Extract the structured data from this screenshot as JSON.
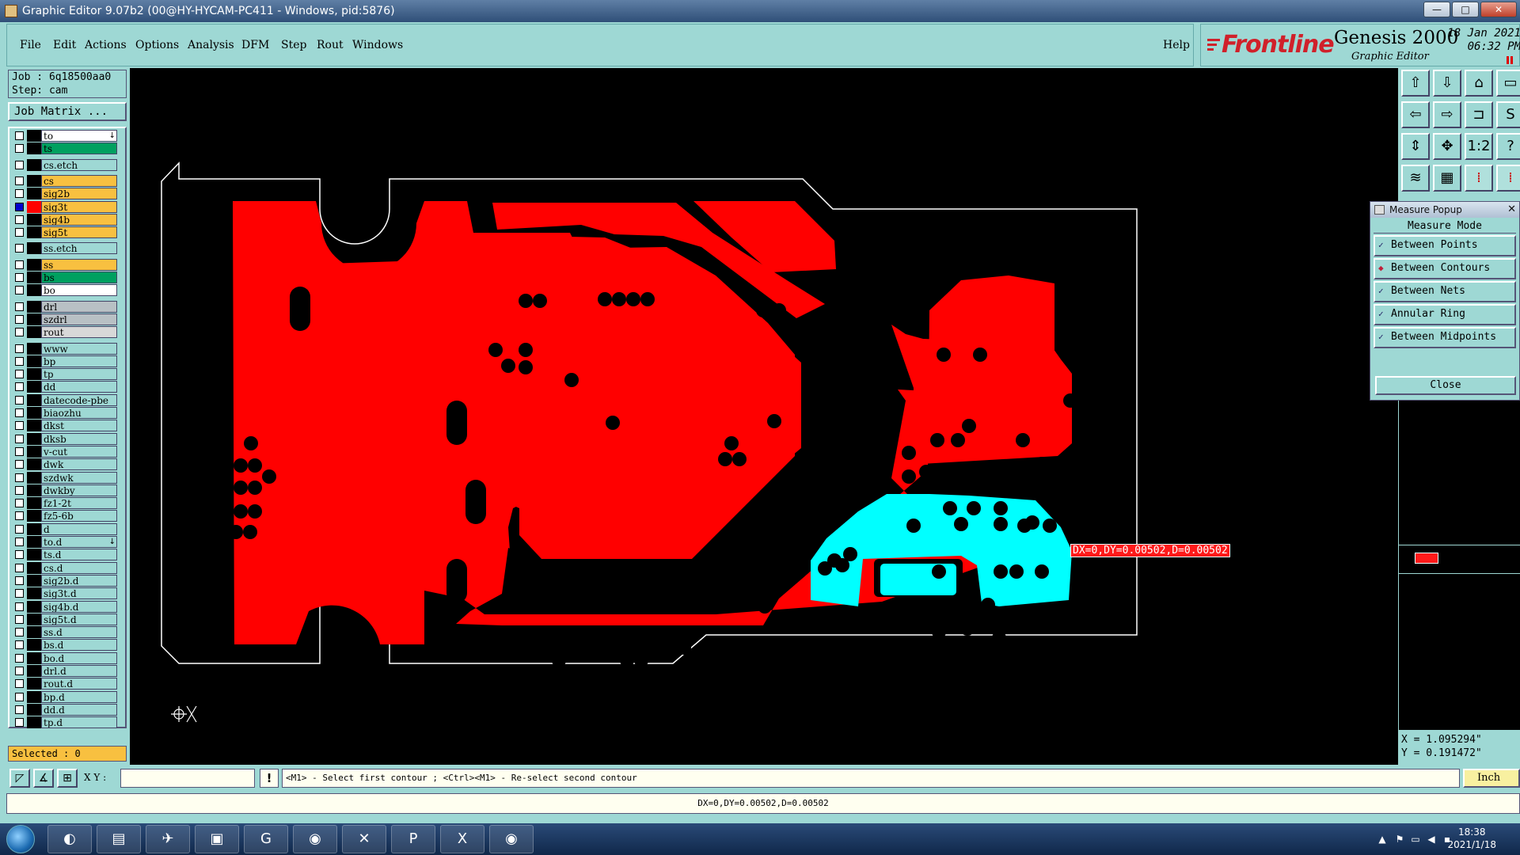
{
  "window": {
    "title": "Graphic Editor 9.07b2 (00@HY-HYCAM-PC411 - Windows, pid:5876)"
  },
  "window_buttons": {
    "minimize": "—",
    "maximize": "□",
    "close": "✕"
  },
  "menu": {
    "items": [
      "File",
      "Edit",
      "Actions",
      "Options",
      "Analysis",
      "DFM",
      "Step",
      "Rout",
      "Windows"
    ],
    "help": "Help"
  },
  "brand": {
    "logo": "Frontline",
    "product": "Genesis 2000",
    "subtitle": "Graphic Editor",
    "date": "18 Jan 2021",
    "time": "06:32 PM"
  },
  "job": {
    "job_line": "Job : 6q18500aa0",
    "step_line": "Step: cam",
    "matrix_button": "Job Matrix ..."
  },
  "layers": [
    {
      "name": "to",
      "color": "#ffffff",
      "mark": "↓"
    },
    {
      "name": "ts",
      "color": "#00a060"
    },
    {
      "name": "cs.etch",
      "color": "#9ed8d4"
    },
    {
      "name": "cs",
      "color": "#f8c040"
    },
    {
      "name": "sig2b",
      "color": "#f8c040"
    },
    {
      "name": "sig3t",
      "color": "#f8c040",
      "selected": true
    },
    {
      "name": "sig4b",
      "color": "#f8c040"
    },
    {
      "name": "sig5t",
      "color": "#f8c040"
    },
    {
      "name": "ss.etch",
      "color": "#9ed8d4"
    },
    {
      "name": "ss",
      "color": "#f8c040"
    },
    {
      "name": "bs",
      "color": "#00a060"
    },
    {
      "name": "bo",
      "color": "#ffffff"
    },
    {
      "name": "drl",
      "color": "#b8c0c4"
    },
    {
      "name": "szdrl",
      "color": "#b8c0c4"
    },
    {
      "name": "rout",
      "color": "#d8d8d8"
    },
    {
      "name": "www",
      "color": "#9ed8d4"
    },
    {
      "name": "bp",
      "color": "#9ed8d4"
    },
    {
      "name": "tp",
      "color": "#9ed8d4"
    },
    {
      "name": "dd",
      "color": "#9ed8d4"
    },
    {
      "name": "datecode-pbe",
      "color": "#9ed8d4"
    },
    {
      "name": "biaozhu",
      "color": "#9ed8d4"
    },
    {
      "name": "dkst",
      "color": "#9ed8d4"
    },
    {
      "name": "dksb",
      "color": "#9ed8d4"
    },
    {
      "name": "v-cut",
      "color": "#9ed8d4"
    },
    {
      "name": "dwk",
      "color": "#9ed8d4"
    },
    {
      "name": "szdwk",
      "color": "#9ed8d4"
    },
    {
      "name": "dwkby",
      "color": "#9ed8d4"
    },
    {
      "name": "fz1-2t",
      "color": "#9ed8d4"
    },
    {
      "name": "fz5-6b",
      "color": "#9ed8d4"
    },
    {
      "name": "d",
      "color": "#9ed8d4"
    },
    {
      "name": "to.d",
      "color": "#9ed8d4",
      "mark": "↓"
    },
    {
      "name": "ts.d",
      "color": "#9ed8d4"
    },
    {
      "name": "cs.d",
      "color": "#9ed8d4"
    },
    {
      "name": "sig2b.d",
      "color": "#9ed8d4"
    },
    {
      "name": "sig3t.d",
      "color": "#9ed8d4"
    },
    {
      "name": "sig4b.d",
      "color": "#9ed8d4"
    },
    {
      "name": "sig5t.d",
      "color": "#9ed8d4"
    },
    {
      "name": "ss.d",
      "color": "#9ed8d4"
    },
    {
      "name": "bs.d",
      "color": "#9ed8d4"
    },
    {
      "name": "bo.d",
      "color": "#9ed8d4"
    },
    {
      "name": "drl.d",
      "color": "#9ed8d4"
    },
    {
      "name": "rout.d",
      "color": "#9ed8d4"
    },
    {
      "name": "bp.d",
      "color": "#9ed8d4"
    },
    {
      "name": "dd.d",
      "color": "#9ed8d4"
    },
    {
      "name": "tp.d",
      "color": "#9ed8d4"
    }
  ],
  "selected_count": "Selected : 0",
  "measure_popup": {
    "title": "Measure Popup",
    "heading": "Measure Mode",
    "modes": [
      {
        "label": "Between Points",
        "active": false
      },
      {
        "label": "Between Contours",
        "active": true
      },
      {
        "label": "Between Nets",
        "active": false
      },
      {
        "label": "Annular Ring",
        "active": false
      },
      {
        "label": "Between Midpoints",
        "active": false
      }
    ],
    "close": "Close"
  },
  "canvas": {
    "measure_label": "DX=0,DY=0.00502,D=0.00502"
  },
  "coords": {
    "x": "X = 1.095294\"",
    "y": "Y = 0.191472\""
  },
  "command": {
    "xy_label": "X Y :",
    "xy_value": "",
    "excl": "!",
    "prompt": "<M1> - Select first contour ; <Ctrl><M1> - Re-select second contour",
    "unit": "Inch"
  },
  "status": "DX=0,DY=0.00502,D=0.00502",
  "taskbar": {
    "time": "18:38",
    "date": "2021/1/18"
  },
  "colors": {
    "panel": "#9ed8d4",
    "copper": "#ff0000",
    "highlight": "#00ffff",
    "layer_selected": "#f8c040"
  }
}
